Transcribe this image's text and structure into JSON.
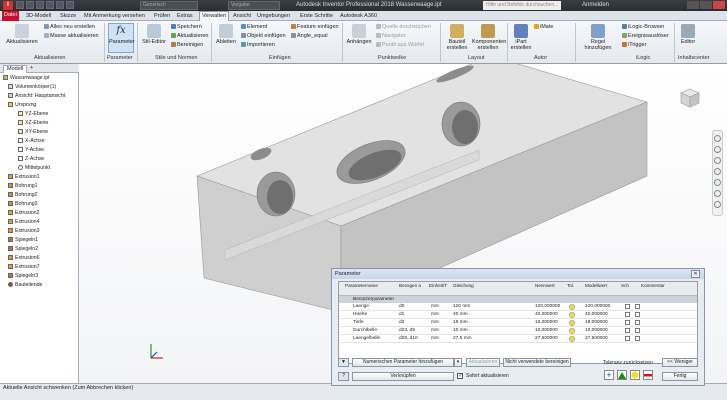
{
  "titlebar": {
    "app_letter": "I",
    "combo_material": "Generisch",
    "combo_appearance": "Vorgabe",
    "window_title": "Autodesk Inventor Professional 2018   Wasserwaage.ipt",
    "search_placeholder": "Hilfe und Befehle durchsuchen...",
    "user": "Anmelden"
  },
  "tabs": [
    "Datei",
    "3D-Modell",
    "Skizze",
    "Mit Anmerkung versehen",
    "Prüfen",
    "Extras",
    "Verwalten",
    "Ansicht",
    "Umgebungen",
    "Erste Schritte",
    "Autodesk A360"
  ],
  "ribbon": {
    "aktualisieren": "Aktualisieren",
    "alles_neu": "Alles neu erstellen",
    "masse_akt": "Masse aktualisieren",
    "parameter": "Parameter",
    "stil_editor": "Stil-Editor",
    "speichern": "Speichern",
    "aktualisieren2": "Aktualisieren",
    "bereinigen": "Bereinigen",
    "ableiten": "Ableiten",
    "element": "Element",
    "objekt_einfuegen": "Objekt einfügen",
    "importieren": "Importieren",
    "feature_einfuegen": "Feature einfügen",
    "angle_equal": "Angle_equal",
    "anhaengen": "Anhängen",
    "quelle": "Quelle durchsuchen",
    "navigator": "Navigator",
    "punkt_zu_wuerfel": "Punkt aus Würfel",
    "bauteil_erstellen": "Bauteil erstellen",
    "komponenten_erstellen": "Komponenten erstellen",
    "ipart": "iPart erstellen",
    "imate": "iMate",
    "regel_hinzufuegen": "Regel hinzufügen",
    "ilogic_browser": "iLogic-Browser",
    "ereignisausloeser": "Ereignisauslöser",
    "itrigger": "iTrigger",
    "editor": "Editor",
    "groups": [
      "Aktualisieren",
      "Parameter",
      "Stile und Normen",
      "Einfügen",
      "Punktwolke",
      "Layout",
      "Autor",
      "iLogic",
      "Inhaltscenter"
    ]
  },
  "modelbar": {
    "tab": "Modell",
    "plus": "+"
  },
  "tree": [
    "Wasserwaage.ipt",
    "Volumenkörper(1)",
    "Ansicht: Hauptansicht",
    "Ursprung",
    "YZ-Ebene",
    "XZ-Ebene",
    "XY-Ebene",
    "X-Achse",
    "Y-Achse",
    "Z-Achse",
    "Mittelpunkt",
    "Extrusion1",
    "Bohrung1",
    "Bohrung2",
    "Bohrung3",
    "Extrusion2",
    "Extrusion4",
    "Extrusion3",
    "Spiegeln1",
    "Spiegeln2",
    "Extrusion6",
    "Extrusion7",
    "Spiegeln3",
    "Bauteilende"
  ],
  "status": "Aktuelle Ansicht schwenken (Zum Abbrechen klicken)",
  "dialog": {
    "title": "Parameter",
    "columns": [
      "Parametername",
      "Bezogen a",
      "Einheit/T",
      "Gleichung",
      "Nennwert",
      "Tol.",
      "Modellwert",
      "Sch",
      "Kommentar"
    ],
    "group": "Benutzerparameter",
    "rows": [
      {
        "name": "Laenge",
        "ref": "d0",
        "unit": "mm",
        "eq": "120 mm",
        "nom": "120,000000",
        "model": "120,000000"
      },
      {
        "name": "Hoehe",
        "ref": "d1",
        "unit": "mm",
        "eq": "40 mm",
        "nom": "40,000000",
        "model": "40,000000"
      },
      {
        "name": "Tiefe",
        "ref": "d2",
        "unit": "mm",
        "eq": "18 mm",
        "nom": "18,000000",
        "model": "18,000000"
      },
      {
        "name": "Durchlbelle",
        "ref": "d23, d5",
        "unit": "mm",
        "eq": "10 mm",
        "nom": "10,000000",
        "model": "10,000000"
      },
      {
        "name": "Laengelbelle",
        "ref": "d28, d10",
        "unit": "mm",
        "eq": "27,5 mm",
        "nom": "27,500000",
        "model": "27,500000"
      }
    ],
    "btn_add": "Numerischen Parameter hinzufügen",
    "btn_update": "Aktualisieren",
    "btn_purge": "Nicht verwendete bereinigen",
    "btn_link": "Verknüpfen",
    "immediate": "Sofort aktualisieren",
    "tol_label": "Toleranz zurücksetzen",
    "btn_less": "<< Weniger",
    "btn_done": "Fertig"
  },
  "colors": {
    "accent": "#c8102e",
    "tolerance": "#f4e01c"
  }
}
